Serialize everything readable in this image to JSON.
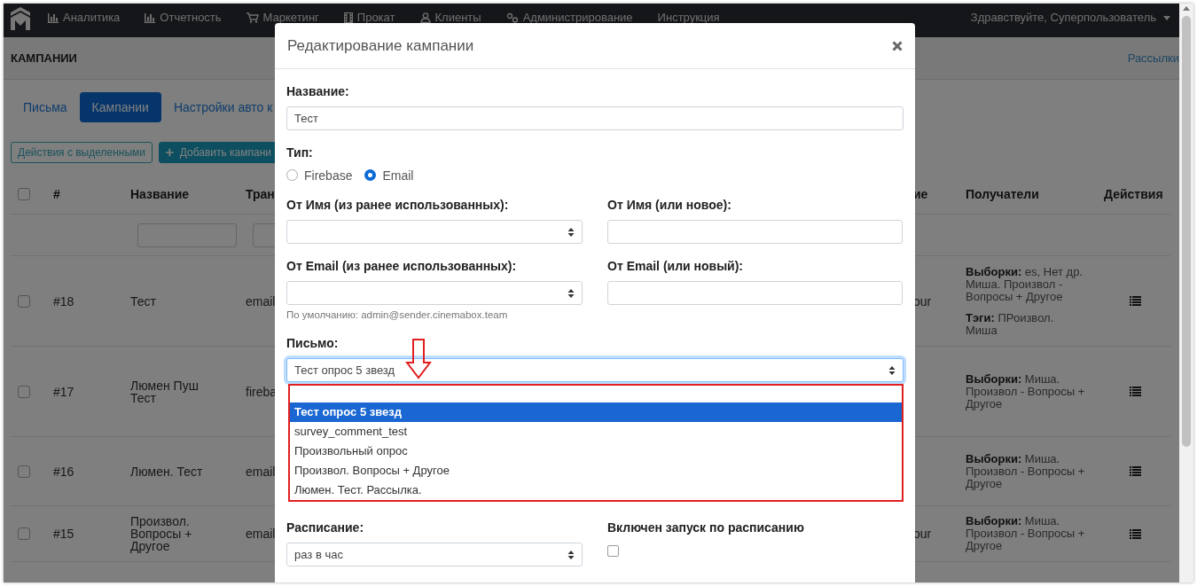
{
  "nav": {
    "items": [
      {
        "label": "Аналитика"
      },
      {
        "label": "Отчетность"
      },
      {
        "label": "Маркетинг"
      },
      {
        "label": "Прокат"
      },
      {
        "label": "Клиенты"
      },
      {
        "label": "Администрирование"
      },
      {
        "label": "Инструкция"
      }
    ],
    "user": "Здравствуйте, Суперпользователь"
  },
  "header": {
    "title": "КАМПАНИИ",
    "link": "Рассылки"
  },
  "tabs": [
    {
      "label": "Письма",
      "selected": false
    },
    {
      "label": "Кампании",
      "selected": true
    },
    {
      "label": "Настройки авто к",
      "selected": false
    }
  ],
  "toolbar": [
    {
      "label": "Действия с выделенными",
      "kind": "outline"
    },
    {
      "label": "Добавить кампани",
      "kind": "add"
    }
  ],
  "table": {
    "select_all_checked": false,
    "columns": [
      "#",
      "Название",
      "Тран",
      "ие",
      "Получатели",
      "Действия"
    ],
    "rows": [
      {
        "checked": false,
        "number": "#18",
        "name": "Тест",
        "column_4": "email",
        "column_5": "our",
        "recipients": [
          "**Выборки:** es, Нет др. Миша. Произвол - Вопросы + Другое",
          "**Тэги:** ПРоизвол. Миша"
        ]
      },
      {
        "checked": false,
        "number": "#17",
        "name": "Люмен Пуш Тест",
        "column_4": "fireba",
        "recipients": [
          "**Выборки:** Миша. Произвол - Вопросы + Другое"
        ]
      },
      {
        "checked": false,
        "number": "#16",
        "name": "Люмен. Тест",
        "column_4": "email",
        "recipients": [
          "**Выборки:** Миша. Произвол - Вопросы + Другое"
        ]
      },
      {
        "checked": false,
        "number": "#15",
        "name": "Произвол. Вопросы + Другое",
        "column_4": "email",
        "column_5": "our",
        "recipients": [
          "**Выборки:** Миша. Произвол - Вопросы + Другое"
        ]
      }
    ]
  },
  "modal": {
    "title": "Редактирование кампании",
    "name": {
      "label": "Название:",
      "value": "Тест"
    },
    "type": {
      "label": "Тип:",
      "options": [
        {
          "label": "Firebase",
          "selected": false
        },
        {
          "label": "Email",
          "selected": true
        }
      ]
    },
    "from_name_select": {
      "label": "От Имя (из ранее использованных):"
    },
    "from_name_new": {
      "label": "От Имя (или новое):"
    },
    "from_email_select": {
      "label": "От Email (из ранее использованных):",
      "help": "По умолчанию: admin@sender.cinemabox.team"
    },
    "from_email_new": {
      "label": "От Email (или новый):"
    },
    "letter": {
      "label": "Письмо:",
      "value": "Тест опрос 5 звезд",
      "options": [
        {
          "label": "Тест опрос 5 звезд",
          "selected": true
        },
        {
          "label": "survey_comment_test",
          "selected": false
        },
        {
          "label": "Произвольный опрос",
          "selected": false
        },
        {
          "label": "Произвол. Вопросы + Другое",
          "selected": false
        },
        {
          "label": "Люмен. Тест. Рассылка.",
          "selected": false
        }
      ]
    },
    "schedule": {
      "label": "Расписание:",
      "value": "раз в час"
    },
    "schedule_enabled": {
      "label": "Включен запуск по расписанию",
      "checked": false
    }
  }
}
